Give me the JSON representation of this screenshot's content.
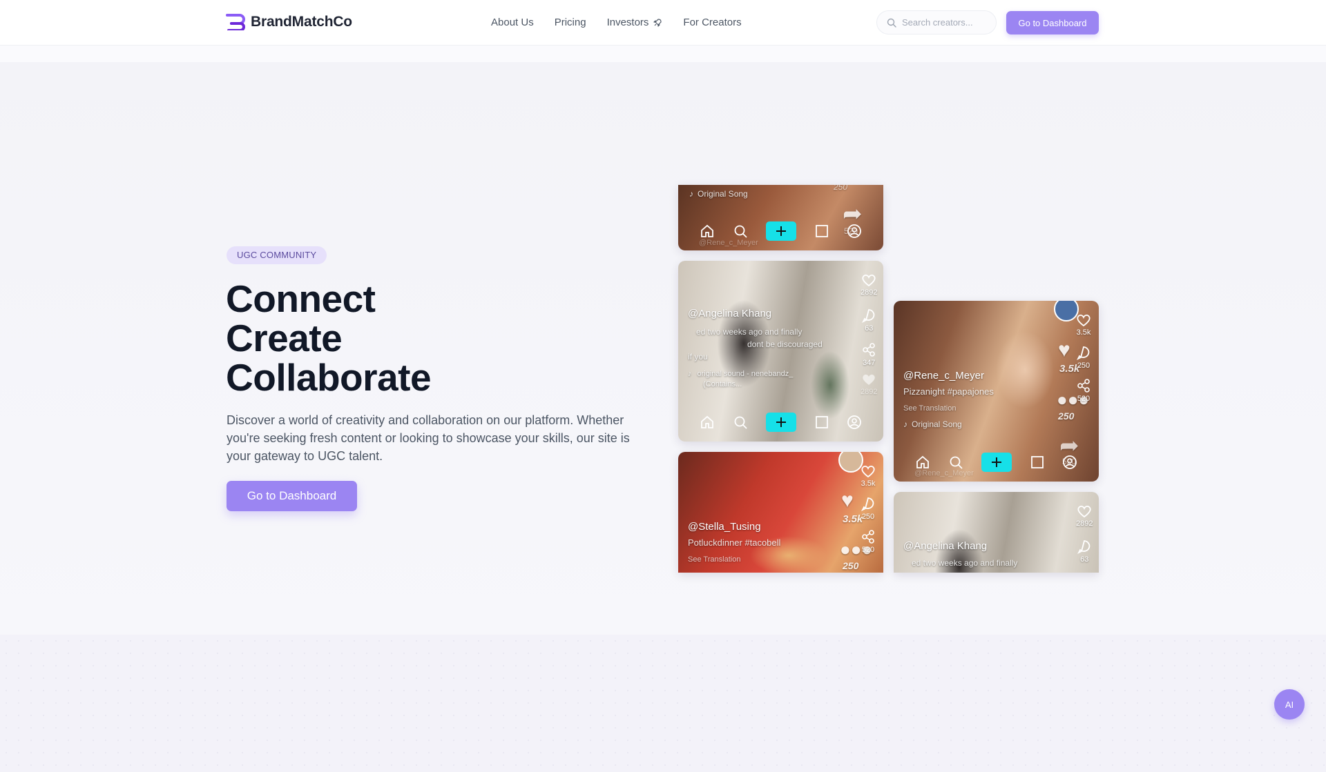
{
  "brand": {
    "name": "BrandMatchCo",
    "accent": "#9b85f2",
    "cyan": "#16e0e8"
  },
  "nav": {
    "items": [
      {
        "label": "About Us"
      },
      {
        "label": "Pricing"
      },
      {
        "label": "Investors",
        "icon": "rocket-icon"
      },
      {
        "label": "For Creators"
      }
    ]
  },
  "search": {
    "placeholder": "Search creators..."
  },
  "header": {
    "dashboard_label": "Go to Dashboard"
  },
  "hero": {
    "badge": "UGC COMMUNITY",
    "headline": [
      "Connect",
      "Create",
      "Collaborate"
    ],
    "lead": "Discover a world of creativity and collaboration on our platform. Whether you're seeking fresh content or looking to showcase your skills, our site is your gateway to UGC talent.",
    "cta_label": "Go to Dashboard"
  },
  "cards": {
    "c1": {
      "song": "Original Song",
      "user": "@Rene_c_Meyer",
      "count_top": "250",
      "count_share": "520"
    },
    "c2": {
      "user": "@Angelina Khang",
      "caption1": "ed two weeks ago and finally",
      "caption2": "dont be discouraged",
      "caption3": "if you",
      "sound1": "original sound - nenebandz_",
      "sound2": "(Contains...",
      "likes": "2892",
      "comments": "63",
      "shares": "347",
      "extra": "2892"
    },
    "c3": {
      "user": "@Rene_c_Meyer",
      "caption": "Pizzanight #papajones",
      "translate": "See Translation",
      "song": "Original Song",
      "likes": "3.5k",
      "comments": "250",
      "shares": "520",
      "big_likes": "3.5k",
      "big_comments": "250",
      "share_big": "520",
      "ghost_user": "@Rene_c_Meyer"
    },
    "c4": {
      "user": "@Stella_Tusing",
      "caption": "Potluckdinner #tacobell",
      "translate": "See Translation",
      "likes": "3.5k",
      "comments": "250",
      "shares": "520",
      "big_likes": "3.5k",
      "big_comments": "250"
    },
    "c5": {
      "user": "@Angelina Khang",
      "caption": "ed two weeks ago and finally",
      "likes": "2892",
      "comments": "63"
    }
  },
  "ai": {
    "label": "AI"
  }
}
